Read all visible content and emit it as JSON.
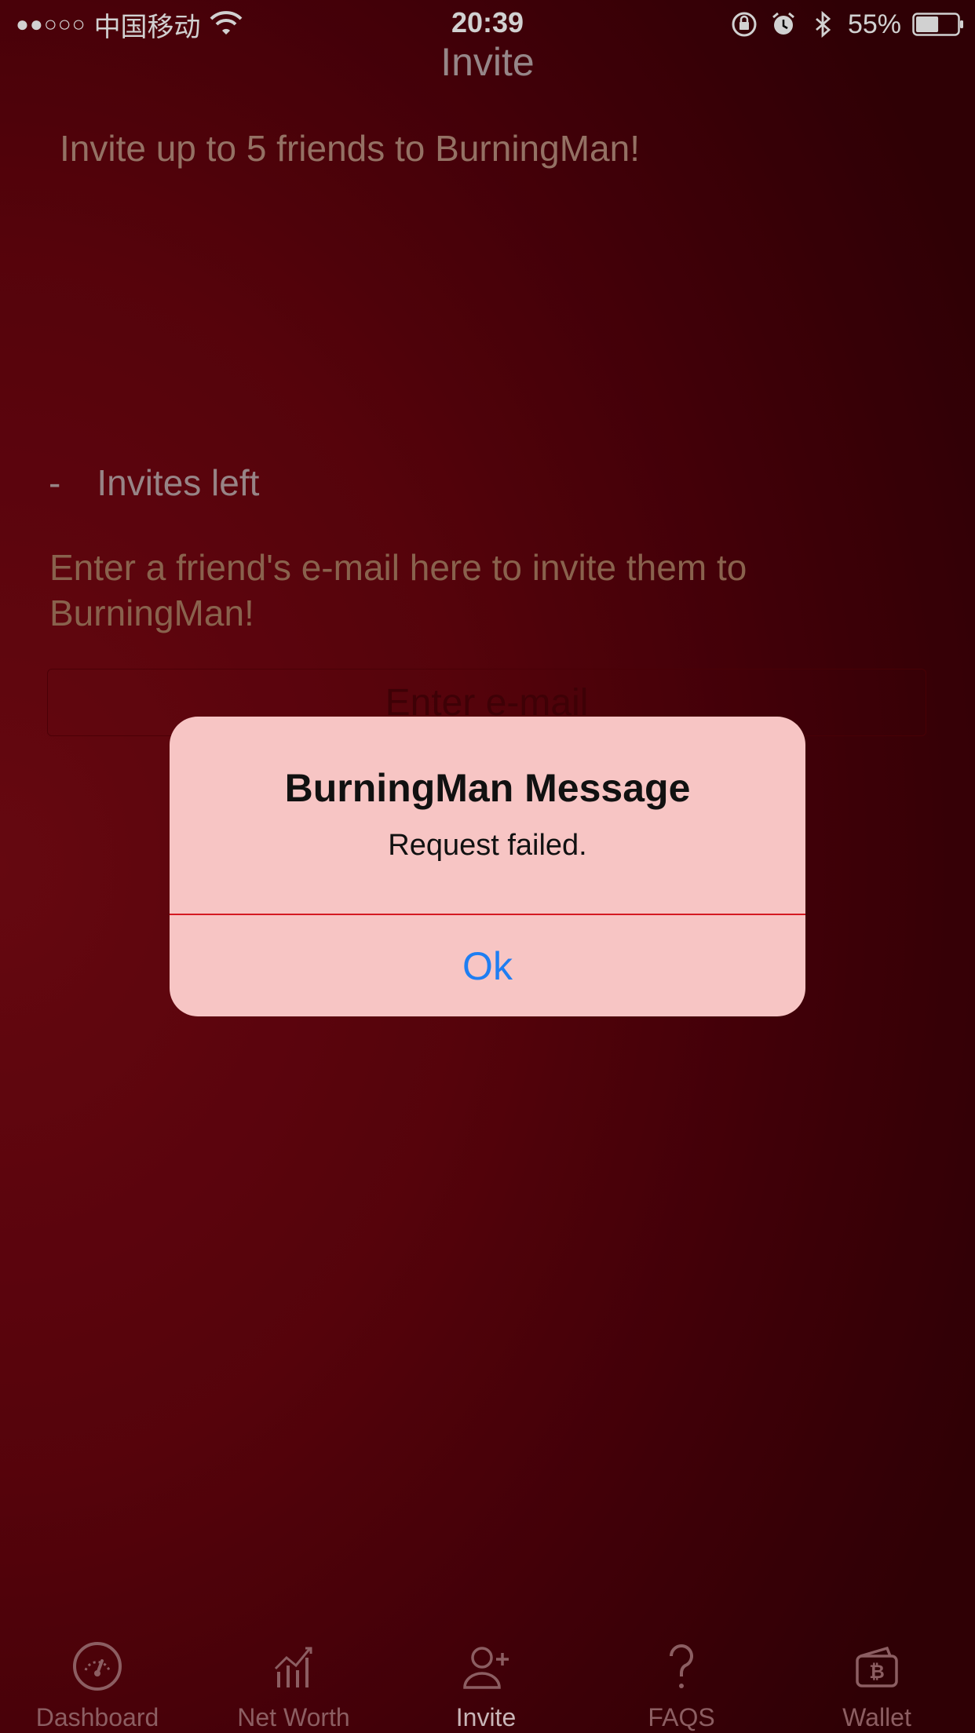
{
  "status_bar": {
    "signal": "●●○○○",
    "carrier": "中国移动",
    "time": "20:39",
    "battery_percent": "55%"
  },
  "header": {
    "title": "Invite"
  },
  "main": {
    "intro": "Invite up to 5 friends to BurningMan!",
    "invites_count": "-",
    "invites_label": "Invites left",
    "instruction": "Enter a friend's e-mail here to invite them to BurningMan!",
    "email_placeholder": "Enter e-mail"
  },
  "alert": {
    "title": "BurningMan Message",
    "message": "Request failed.",
    "ok_label": "Ok"
  },
  "tabs": [
    {
      "label": "Dashboard",
      "icon": "gauge-icon"
    },
    {
      "label": "Net Worth",
      "icon": "bar-chart-icon"
    },
    {
      "label": "Invite",
      "icon": "add-user-icon",
      "active": true
    },
    {
      "label": "FAQS",
      "icon": "question-icon"
    },
    {
      "label": "Wallet",
      "icon": "bitcoin-wallet-icon"
    }
  ],
  "colors": {
    "alert_background": "#f7c5c4",
    "alert_divider": "#d41a22",
    "ok_button": "#1f7ef2",
    "background": "#6b040e"
  }
}
